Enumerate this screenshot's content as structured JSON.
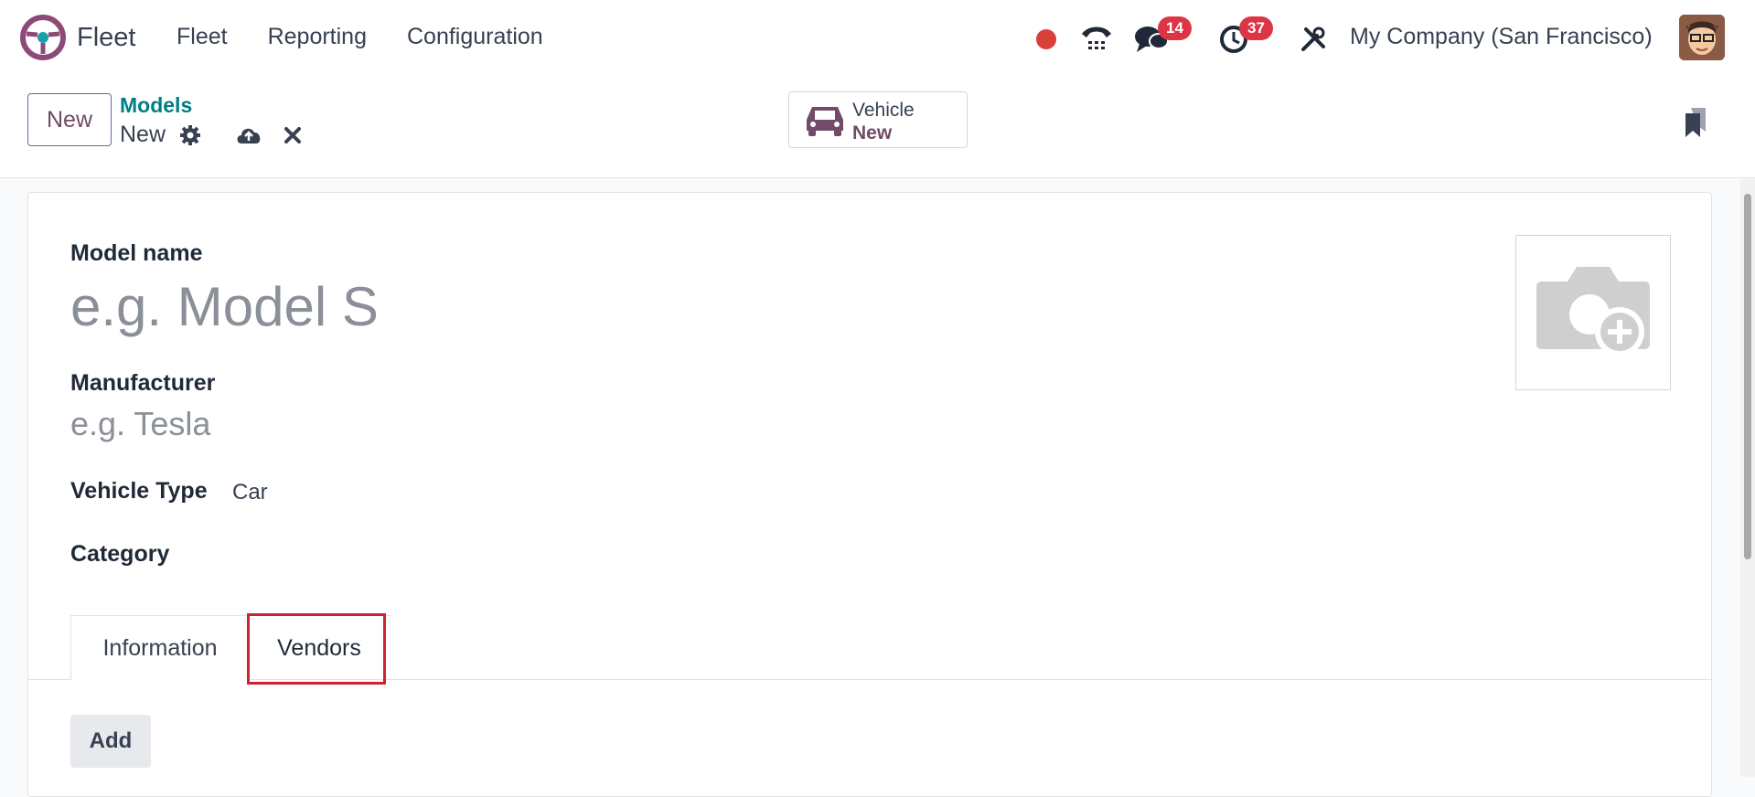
{
  "app": {
    "name": "Fleet"
  },
  "menu": [
    "Fleet",
    "Reporting",
    "Configuration"
  ],
  "systray": {
    "messages_count": "14",
    "activities_count": "37",
    "company": "My Company (San Francisco)"
  },
  "control": {
    "new_label": "New",
    "breadcrumb_parent": "Models",
    "breadcrumb_current": "New"
  },
  "smart_button": {
    "line1": "Vehicle",
    "line2": "New"
  },
  "form": {
    "model_name_label": "Model name",
    "model_name_placeholder": "e.g. Model S",
    "manufacturer_label": "Manufacturer",
    "manufacturer_placeholder": "e.g. Tesla",
    "vehicle_type_label": "Vehicle Type",
    "vehicle_type_value": "Car",
    "category_label": "Category"
  },
  "tabs": [
    "Information",
    "Vendors"
  ],
  "vendors": {
    "add_label": "Add"
  },
  "colors": {
    "brand": "#714b67",
    "link": "#017e84",
    "badge": "#dc3545",
    "highlight": "#d0232f"
  }
}
